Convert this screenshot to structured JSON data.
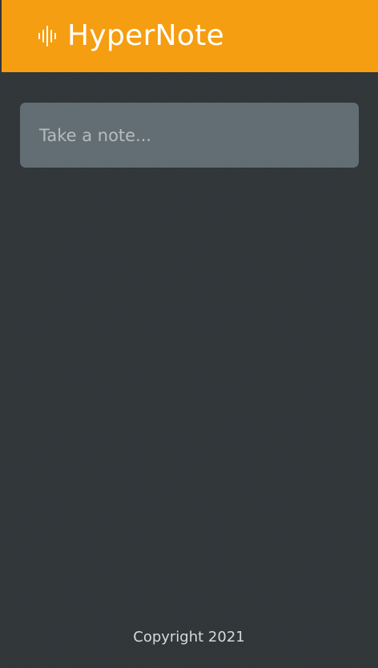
{
  "header": {
    "brand_icon": "audio-waveform-icon",
    "title": "HyperNote",
    "background_color": "#f59e12"
  },
  "note": {
    "placeholder": "Take a note...",
    "value": ""
  },
  "footer": {
    "copyright": "Copyright 2021"
  },
  "colors": {
    "page_background": "#32373a",
    "input_background": "#636e74",
    "text_light": "#ffffff"
  }
}
